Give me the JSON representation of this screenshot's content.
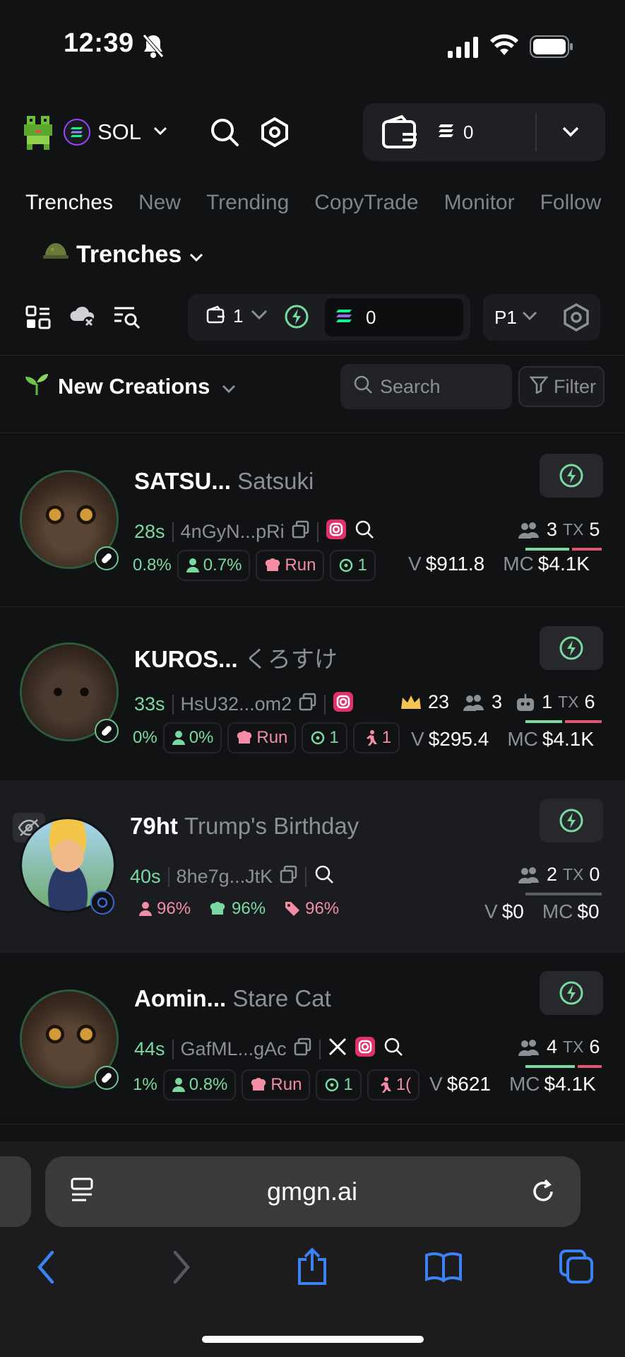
{
  "status": {
    "time": "12:39"
  },
  "top": {
    "chain": "SOL",
    "wallet_count": "0"
  },
  "tabs": [
    "Trenches",
    "New",
    "Trending",
    "CopyTrade",
    "Monitor",
    "Follow"
  ],
  "section": {
    "title": "Trenches"
  },
  "controls": {
    "wallet_num": "1",
    "balance": "0",
    "preset": "P1"
  },
  "creations": {
    "title": "New Creations",
    "search_placeholder": "Search",
    "filter_label": "Filter"
  },
  "tokens": [
    {
      "symbol": "SATSU...",
      "name": "Satsuki",
      "age": "28s",
      "address": "4nGyN...pRi",
      "chips": [
        "0.8%",
        "0.7%",
        "Run",
        "1"
      ],
      "holders": "3",
      "tx": "5",
      "v_label": "V",
      "volume": "$911.8",
      "mc_label": "MC",
      "mc": "$4.1K"
    },
    {
      "symbol": "KUROS...",
      "name": "くろすけ",
      "age": "33s",
      "address": "HsU32...om2",
      "crown": "23",
      "chips": [
        "0%",
        "0%",
        "Run",
        "1",
        "1"
      ],
      "holders": "3",
      "bots": "1",
      "tx": "6",
      "v_label": "V",
      "volume": "$295.4",
      "mc_label": "MC",
      "mc": "$4.1K"
    },
    {
      "symbol": "79ht",
      "name": "Trump's Birthday",
      "age": "40s",
      "address": "8he7g...JtK",
      "chips": [
        "96%",
        "96%",
        "96%"
      ],
      "holders": "2",
      "tx": "0",
      "v_label": "V",
      "volume": "$0",
      "mc_label": "MC",
      "mc": "$0"
    },
    {
      "symbol": "Aomin...",
      "name": "Stare Cat",
      "age": "44s",
      "address": "GafML...gAc",
      "chips": [
        "1%",
        "0.8%",
        "Run",
        "1",
        "1("
      ],
      "holders": "4",
      "tx": "6",
      "v_label": "V",
      "volume": "$621",
      "mc_label": "MC",
      "mc": "$4.1K"
    }
  ],
  "browser": {
    "url": "gmgn.ai"
  },
  "labels": {
    "tx": "TX"
  },
  "colors": {
    "accent": "#7ad9a1",
    "danger": "#e0566f",
    "bg": "#111214"
  }
}
